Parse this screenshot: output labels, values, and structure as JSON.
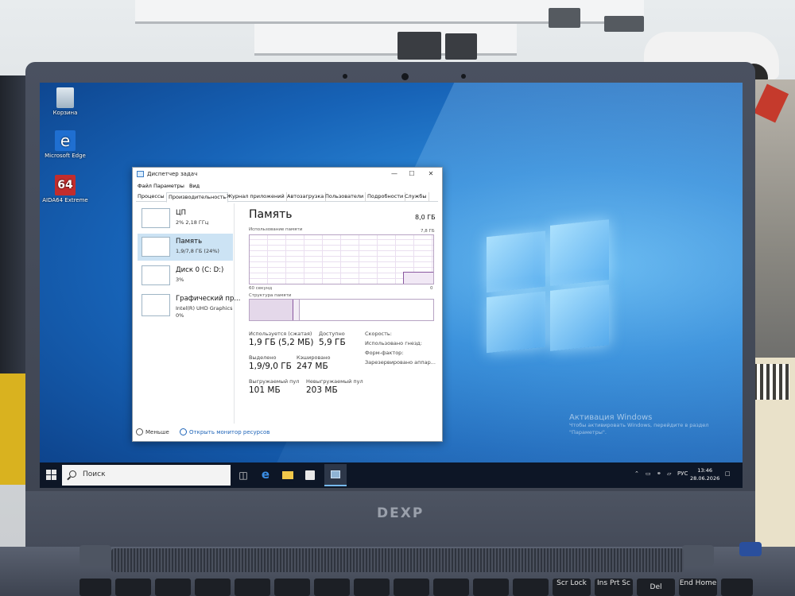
{
  "desktop": {
    "icons": [
      {
        "label": "Корзина",
        "icon": "recycle-bin-icon"
      },
      {
        "label": "Microsoft Edge",
        "icon": "edge-icon"
      },
      {
        "label": "AIDA64 Extreme",
        "icon": "aida64-icon"
      }
    ],
    "activation_title": "Активация Windows",
    "activation_text_1": "Чтобы активировать Windows, перейдите в раздел",
    "activation_text_2": "\"Параметры\"."
  },
  "laptop": {
    "brand": "DEXP"
  },
  "task_manager": {
    "title": "Диспетчер задач",
    "menu": [
      "Файл",
      "Параметры",
      "Вид"
    ],
    "tabs": [
      "Процессы",
      "Производительность",
      "Журнал приложений",
      "Автозагрузка",
      "Пользователи",
      "Подробности",
      "Службы"
    ],
    "active_tab": "Производительность",
    "sidebar": [
      {
        "name": "ЦП",
        "value": "2% 2,18 ГГц",
        "value2": ""
      },
      {
        "name": "Память",
        "value": "1,9/7,8 ГБ (24%)",
        "value2": ""
      },
      {
        "name": "Диск 0 (C: D:)",
        "value": "3%",
        "value2": ""
      },
      {
        "name": "Графический пр...",
        "value": "Intel(R) UHD Graphics",
        "value2": "0%"
      }
    ],
    "main": {
      "title": "Память",
      "total": "8,0 ГБ",
      "usage_label": "Использование памяти",
      "usage_max": "7,8 ГБ",
      "time_label": "60 секунд",
      "time_end": "0",
      "structure_label": "Структура памяти",
      "in_use_fraction": 0.24,
      "stats": {
        "in_use_label": "Используется (сжатая)",
        "in_use_value": "1,9 ГБ (5,2 МБ)",
        "available_label": "Доступно",
        "available_value": "5,9 ГБ",
        "committed_label": "Выделено",
        "committed_value": "1,9/9,0 ГБ",
        "cached_label": "Кэшировано",
        "cached_value": "247 МБ",
        "paged_label": "Выгружаемый пул",
        "paged_value": "101 МБ",
        "nonpaged_label": "Невыгружаемый пул",
        "nonpaged_value": "203 МБ",
        "speed_label": "Скорость:",
        "slots_label": "Использовано гнезд:",
        "form_label": "Форм-фактор:",
        "reserved_label": "Зарезервировано аппар..."
      }
    },
    "footer": {
      "less": "Меньше",
      "resource_monitor": "Открыть монитор ресурсов"
    }
  },
  "taskbar": {
    "search_placeholder": "Поиск",
    "language": "РУС",
    "time": "13:46",
    "date": "28.06.2026",
    "pinned": [
      "task-view-icon",
      "edge-icon",
      "file-explorer-icon",
      "store-icon",
      "task-manager-icon"
    ]
  },
  "keyboard": {
    "keys": [
      "Scr Lock",
      "Ins Prt Sc",
      "Del",
      "End Home"
    ]
  },
  "colors": {
    "desktop_blue": "#1763b7",
    "taskbar": "#0d1626",
    "selection": "#cce3f4",
    "memory_purple": "#8a58a0",
    "link": "#1e64b8"
  }
}
